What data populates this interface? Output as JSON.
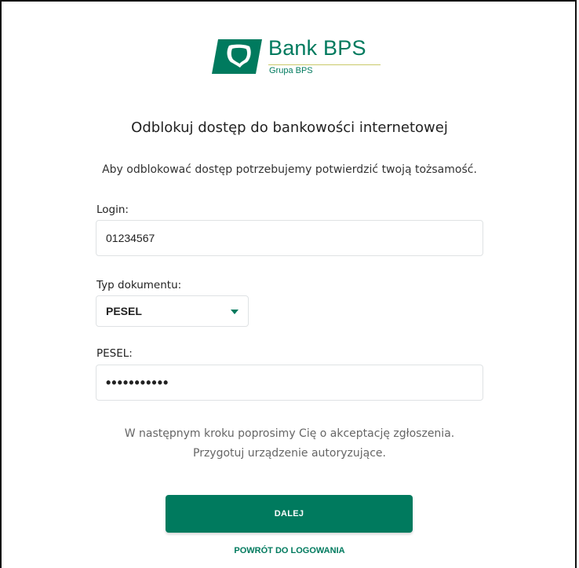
{
  "brand": {
    "name": "Bank BPS",
    "subtitle": "Grupa BPS",
    "color": "#007a5e"
  },
  "page": {
    "title": "Odblokuj dostęp do bankowości internetowej",
    "intro": "Aby odblokować dostęp potrzebujemy potwierdzić twoją tożsamość."
  },
  "form": {
    "login": {
      "label": "Login:",
      "value": "01234567"
    },
    "document_type": {
      "label": "Typ dokumentu:",
      "selected": "PESEL",
      "icon": "chevron-down-icon"
    },
    "pesel": {
      "label": "PESEL:",
      "value": "•••••••••••"
    }
  },
  "info": {
    "line1": "W następnym kroku poprosimy Cię o akceptację zgłoszenia.",
    "line2": "Przygotuj urządzenie autoryzujące."
  },
  "actions": {
    "next_label": "DALEJ",
    "back_label": "POWRÓT DO LOGOWANIA"
  }
}
